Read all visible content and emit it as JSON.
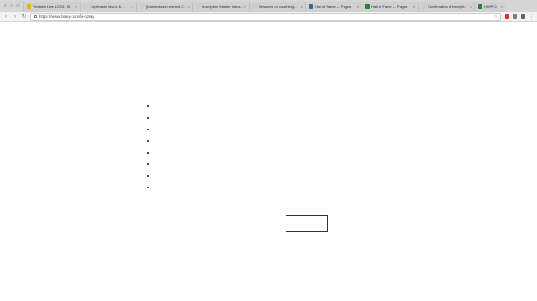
{
  "browser": {
    "tabs": [
      {
        "label": "Youtube Live 12/03 - Si",
        "favicon_color": "#e8b400",
        "active": false
      },
      {
        "label": "L'optimiste, lavoix & ...",
        "favicon_color": "#cccccc",
        "active": false
      },
      {
        "label": "[Masterclass Léonard G...",
        "favicon_color": "#cccccc",
        "active": false
      },
      {
        "label": "Inscription Master Indus...",
        "favicon_color": "#cccccc",
        "active": false
      },
      {
        "label": "Réserver un coaching ...",
        "favicon_color": "#cccccc",
        "active": false
      },
      {
        "label": "Hall of Fame — Pages",
        "favicon_color": "#3b5b9c",
        "active": false
      },
      {
        "label": "Hall of Fame — Pages",
        "favicon_color": "#2e7d32",
        "active": false
      },
      {
        "label": "Confirmation d'inscripti...",
        "favicon_color": "#cccccc",
        "active": false
      },
      {
        "label": "HIWPO",
        "favicon_color": "#2e7d32",
        "active": false
      }
    ],
    "close_glyph": "×",
    "back_glyph": "‹",
    "forward_glyph": "›",
    "reload_glyph": "↻",
    "url": "https://www.lsaey.com/bi-ozray",
    "star_glyph": "☆",
    "menu_glyph": "⋮",
    "extension_colors": [
      "#d93025",
      "#7f7f7f",
      "#5f6368"
    ]
  },
  "page": {
    "bullet_items": [
      "",
      "",
      "",
      "",
      "",
      "",
      "",
      ""
    ],
    "box_text": ""
  }
}
